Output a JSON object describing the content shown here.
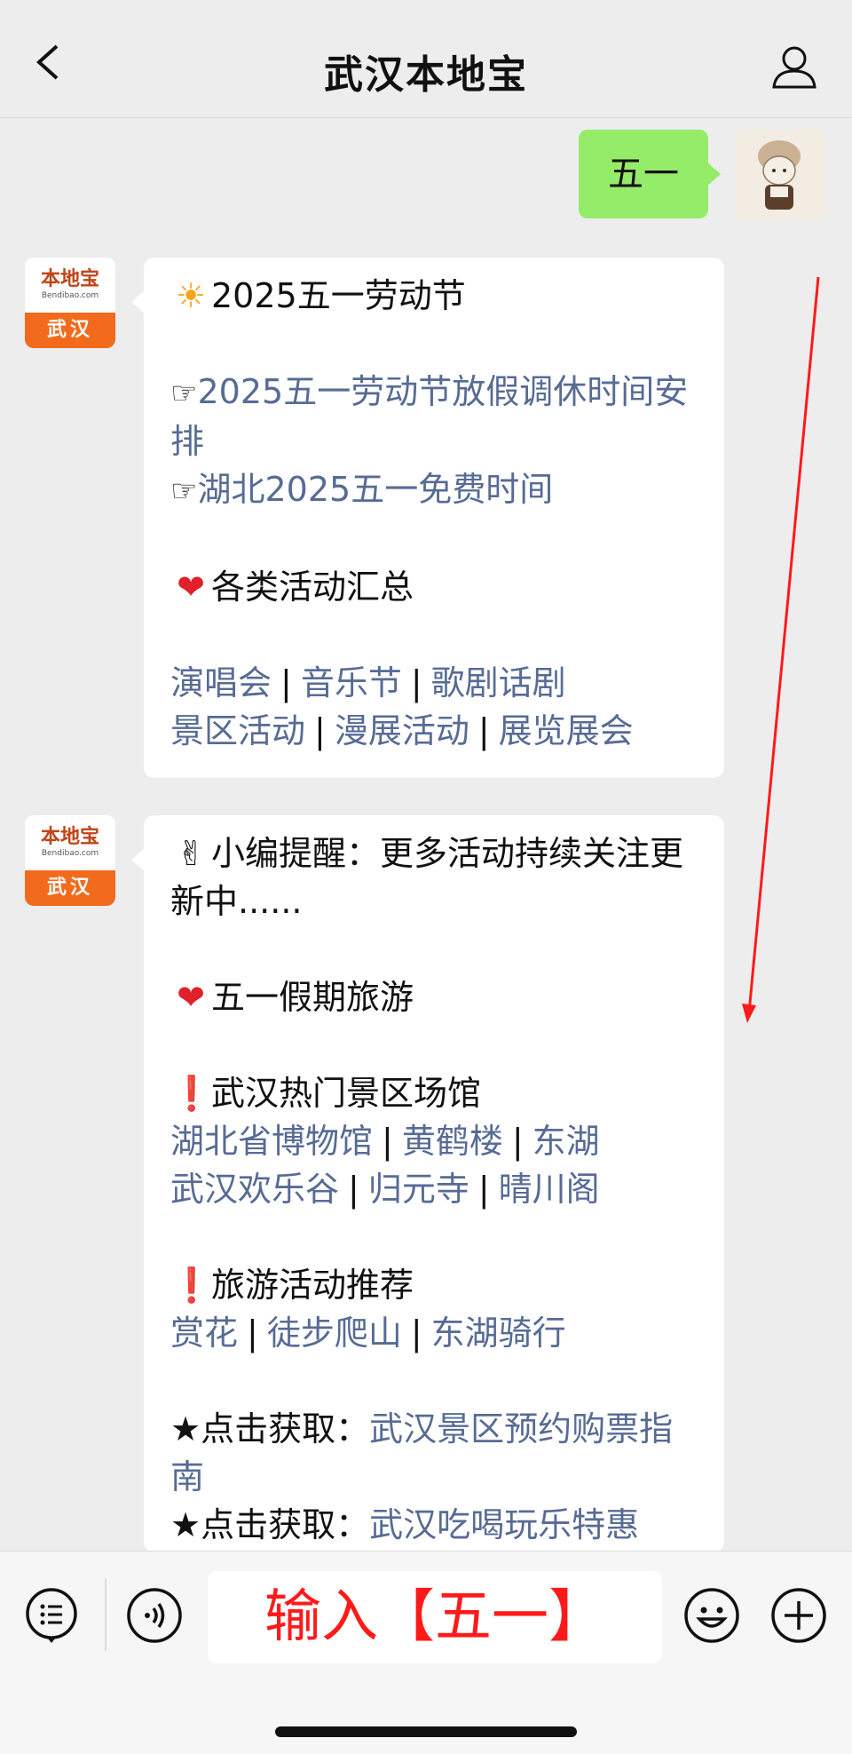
{
  "header": {
    "title": "武汉本地宝"
  },
  "outgoing": {
    "text": "五一"
  },
  "bot": {
    "logo_text": "本地宝",
    "logo_sub": "Bendibao.com",
    "logo_city": "武汉"
  },
  "message1": {
    "title": "2025五一劳动节",
    "link1": "2025五一劳动节放假调休时间安排",
    "link2": "湖北2025五一免费时间",
    "section": "各类活动汇总",
    "row1": [
      "演唱会",
      "音乐节",
      "歌剧话剧"
    ],
    "row2": [
      "景区活动",
      "漫展活动",
      "展览展会"
    ]
  },
  "message2": {
    "reminder": "小编提醒：更多活动持续关注更新中......",
    "section1": "五一假期旅游",
    "sub1": "武汉热门景区场馆",
    "row1": [
      "湖北省博物馆",
      "黄鹤楼",
      "东湖"
    ],
    "row2": [
      "武汉欢乐谷",
      "归元寺",
      "晴川阁"
    ],
    "sub2": "旅游活动推荐",
    "row3": [
      "赏花",
      "徒步爬山",
      "东湖骑行"
    ],
    "cta_label": "★点击获取：",
    "cta1_link": "武汉景区预约购票指南",
    "cta2_link": "武汉吃喝玩乐特惠"
  },
  "input": {
    "text": "输入【五一】"
  },
  "colors": {
    "link": "#576b95",
    "bubble_out": "#95ec69",
    "annotation": "#ff1a1a"
  }
}
